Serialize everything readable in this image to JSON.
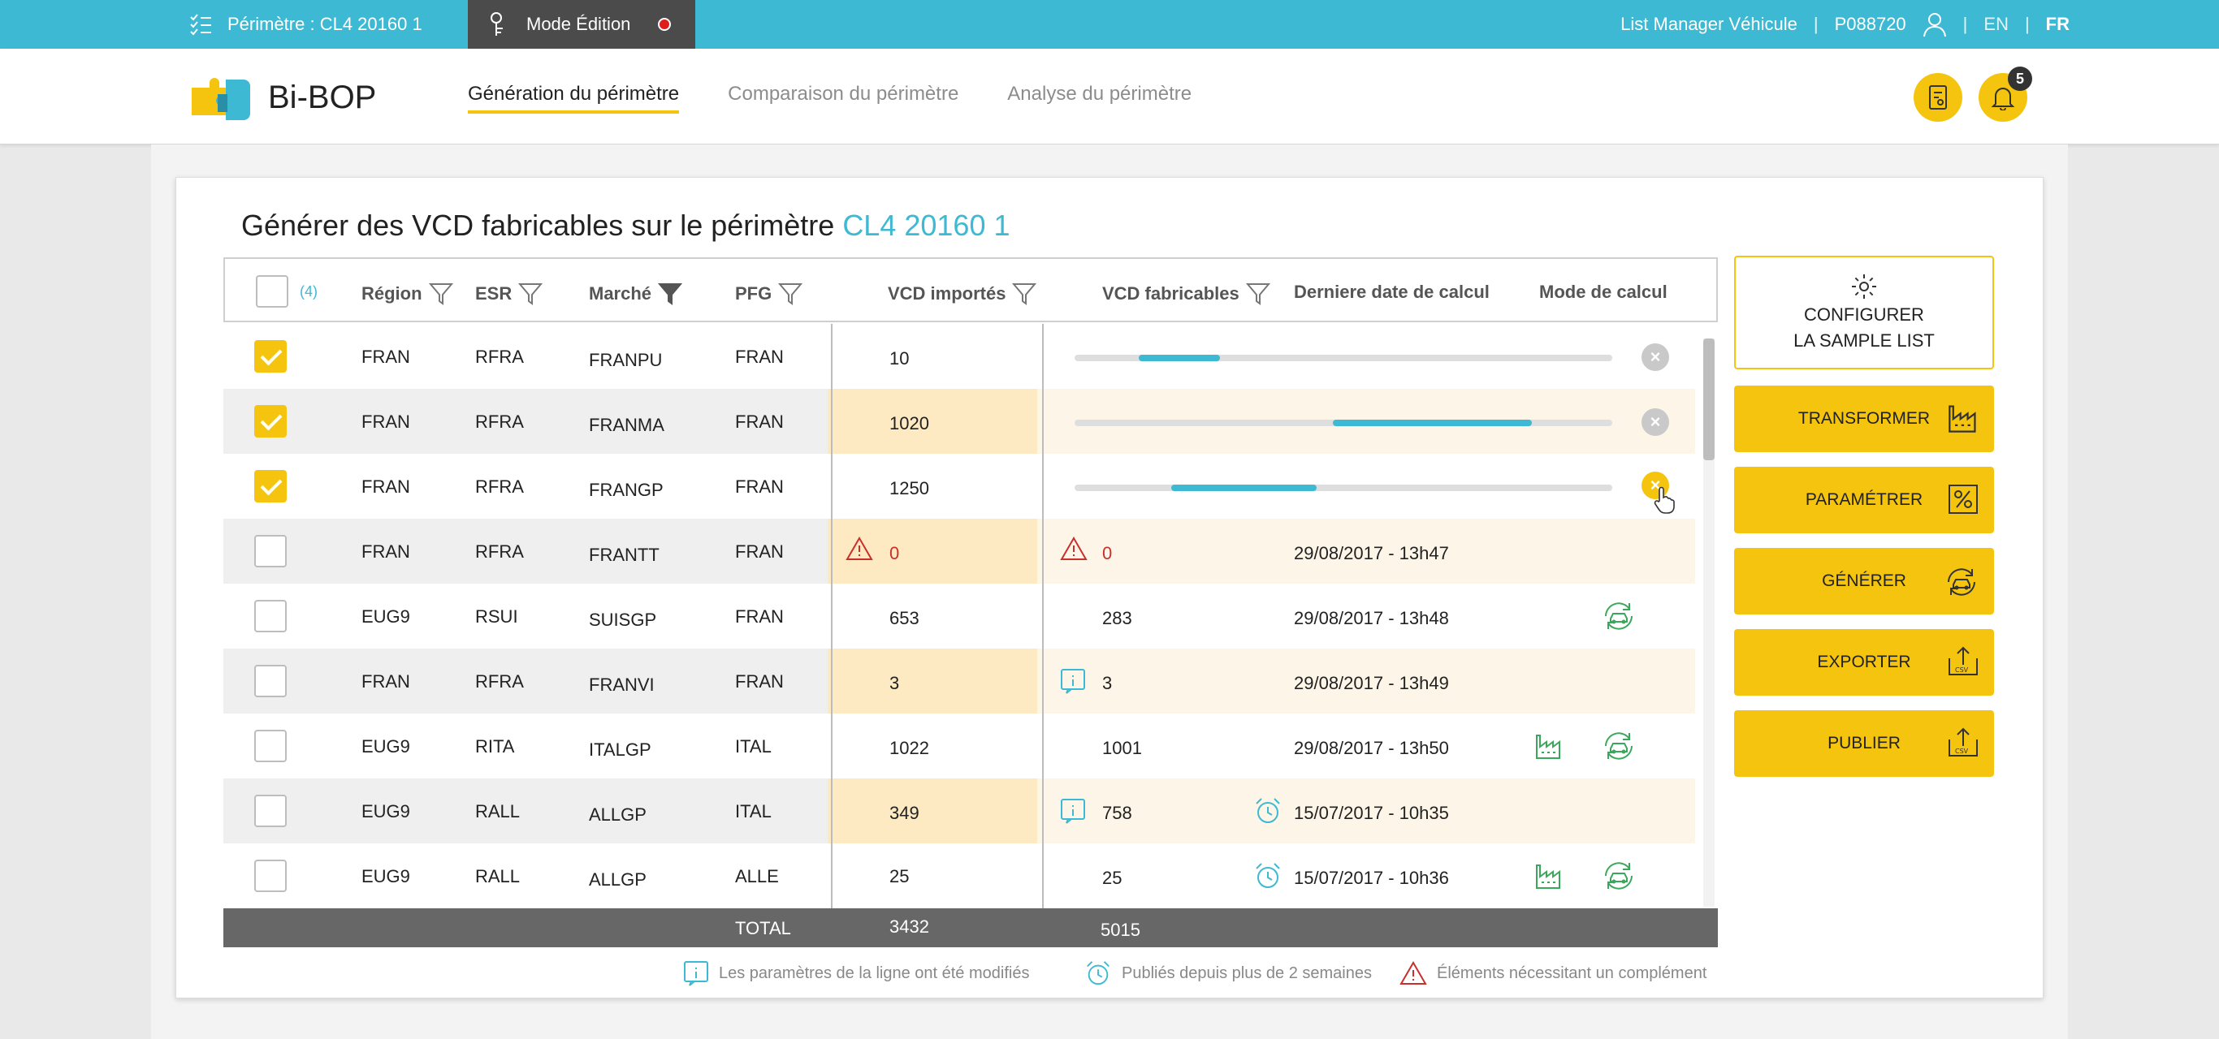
{
  "topbar": {
    "perimetre": "Périmètre : CL4 20160 1",
    "mode": "Mode Édition",
    "app": "List Manager Véhicule",
    "sep": "|",
    "user": "P088720",
    "lang_en": "EN",
    "lang_fr": "FR"
  },
  "header": {
    "logo": "Bi-BOP",
    "nav": [
      "Génération du périmètre",
      "Comparaison du périmètre",
      "Analyse du périmètre"
    ],
    "notifications": "5"
  },
  "page": {
    "title_prefix": "Générer des VCD fabricables sur le périmètre ",
    "title_accent": "CL4 20160 1"
  },
  "table": {
    "selected_count": "(4)",
    "headers": {
      "region": "Région",
      "esr": "ESR",
      "marche": "Marché",
      "pfg": "PFG",
      "imp": "VCD importés",
      "fab": "VCD fabricables",
      "date": "Derniere date de calcul",
      "mode": "Mode de calcul"
    },
    "rows": [
      {
        "checked": true,
        "region": "FRAN",
        "esr": "RFRA",
        "marche": "FRANPU",
        "pfg": "FRAN",
        "imp": "10",
        "fab": "",
        "date": "",
        "progress": [
          0.12,
          0.27
        ]
      },
      {
        "checked": true,
        "region": "FRAN",
        "esr": "RFRA",
        "marche": "FRANMA",
        "pfg": "FRAN",
        "imp": "1020",
        "fab": "",
        "date": "",
        "progress": [
          0.48,
          0.85
        ]
      },
      {
        "checked": true,
        "region": "FRAN",
        "esr": "RFRA",
        "marche": "FRANGP",
        "pfg": "FRAN",
        "imp": "1250",
        "fab": "",
        "date": "",
        "progress": [
          0.18,
          0.45
        ]
      },
      {
        "checked": false,
        "region": "FRAN",
        "esr": "RFRA",
        "marche": "FRANTT",
        "pfg": "FRAN",
        "imp": "0",
        "fab": "0",
        "date": "29/08/2017 - 13h47"
      },
      {
        "checked": false,
        "region": "EUG9",
        "esr": "RSUI",
        "marche": "SUISGP",
        "pfg": "FRAN",
        "imp": "653",
        "fab": "283",
        "date": "29/08/2017 - 13h48"
      },
      {
        "checked": false,
        "region": "FRAN",
        "esr": "RFRA",
        "marche": "FRANVI",
        "pfg": "FRAN",
        "imp": "3",
        "fab": "3",
        "date": "29/08/2017 - 13h49"
      },
      {
        "checked": false,
        "region": "EUG9",
        "esr": "RITA",
        "marche": "ITALGP",
        "pfg": "ITAL",
        "imp": "1022",
        "fab": "1001",
        "date": "29/08/2017 - 13h50"
      },
      {
        "checked": false,
        "region": "EUG9",
        "esr": "RALL",
        "marche": "ALLGP",
        "pfg": "ITAL",
        "imp": "349",
        "fab": "758",
        "date": "15/07/2017 - 10h35"
      },
      {
        "checked": false,
        "region": "EUG9",
        "esr": "RALL",
        "marche": "ALLGP",
        "pfg": "ALLE",
        "imp": "25",
        "fab": "25",
        "date": "15/07/2017 - 10h36"
      }
    ],
    "total_label": "TOTAL",
    "total_imp": "3432",
    "total_fab": "5015"
  },
  "legend": {
    "modified": "Les paramètres de la ligne ont été modifiés",
    "published": "Publiés depuis plus de 2 semaines",
    "warning": "Éléments nécessitant un complément"
  },
  "actions": {
    "configure_line1": "CONFIGURER",
    "configure_line2": "LA SAMPLE LIST",
    "transformer": "TRANSFORMER",
    "parametrer": "PARAMÉTRER",
    "generer": "GÉNÉRER",
    "exporter": "EXPORTER",
    "publier": "PUBLIER"
  },
  "colors": {
    "accent_blue": "#3db9d3",
    "accent_yellow": "#f5c40f",
    "dark": "#4b4b4b",
    "warning_red": "#c9302c",
    "success_green": "#3aa85b"
  }
}
